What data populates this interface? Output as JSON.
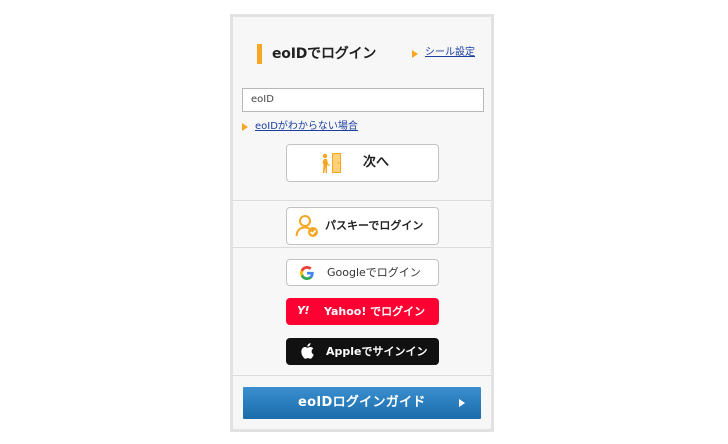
{
  "header": {
    "title": "eoIDでログイン",
    "seal_link": "シール設定"
  },
  "form": {
    "eoid_value": "eoID",
    "forgot_link": "eoIDがわからない場合",
    "next_label": "次へ"
  },
  "login_options": {
    "passkey_label": "パスキーでログイン",
    "google_label": "Googleでログイン",
    "yahoo_logo": "Y!",
    "yahoo_label": "Yahoo! でログイン",
    "apple_label": "Appleでサインイン"
  },
  "guide": {
    "label": "eoIDログインガイド"
  },
  "colors": {
    "accent": "#f6a623",
    "link": "#1a3fa0",
    "yahoo": "#ff0033",
    "apple": "#111111",
    "guide_top": "#3b8fcf",
    "guide_bottom": "#1a6cab"
  },
  "icons": {
    "next": "door-exit-icon",
    "passkey": "user-check-icon",
    "google": "google-g-icon",
    "apple": "apple-logo-icon",
    "guide": "triangle-right-icon"
  }
}
